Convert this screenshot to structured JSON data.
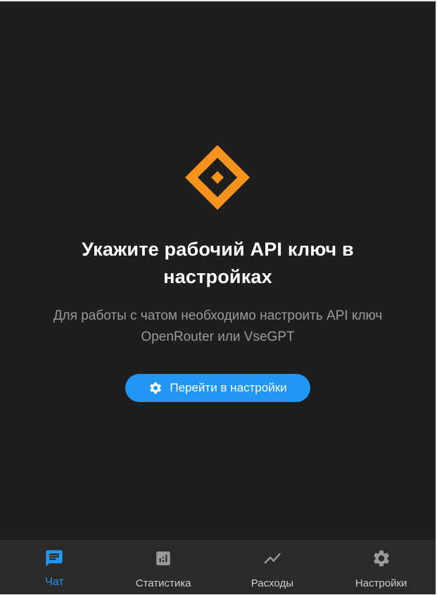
{
  "empty_state": {
    "title": "Укажите рабочий API ключ в настройках",
    "subtitle": "Для работы с чатом необходимо настроить API ключ OpenRouter или VseGPT",
    "button_label": "Перейти в настройки",
    "button_icon": "gear-icon",
    "logo_icon": "diamond-logo-icon"
  },
  "bottom_nav": {
    "items": [
      {
        "label": "Чат",
        "icon": "chat-icon",
        "active": true
      },
      {
        "label": "Статистика",
        "icon": "bar-chart-icon",
        "active": false
      },
      {
        "label": "Расходы",
        "icon": "trend-line-icon",
        "active": false
      },
      {
        "label": "Настройки",
        "icon": "gear-icon",
        "active": false
      }
    ]
  },
  "colors": {
    "background": "#1e1e1f",
    "nav_background": "#2a2a2b",
    "accent": "#2196f3",
    "logo": "#f7931a",
    "inactive_icon": "#9a9a9a"
  }
}
